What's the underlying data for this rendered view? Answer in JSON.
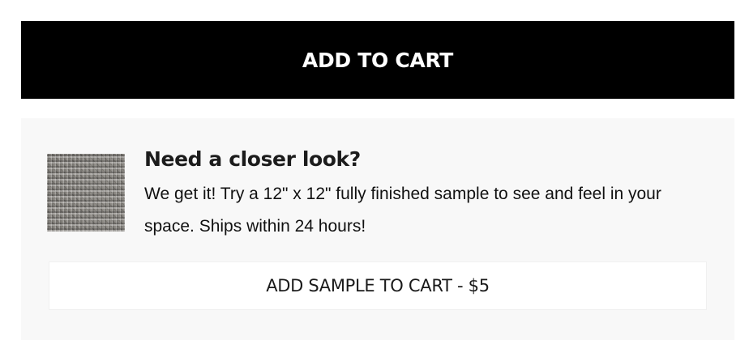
{
  "primary_action": {
    "label": "ADD TO CART"
  },
  "sample_offer": {
    "swatch_icon": "fabric-swatch-image",
    "heading": "Need a closer look?",
    "description": "We get it! Try a 12\" x 12\" fully finished sample to see and feel in your space. Ships within 24 hours!",
    "button_label": "ADD SAMPLE TO CART - $5"
  },
  "colors": {
    "primary_button_bg": "#000000",
    "primary_button_text": "#ffffff",
    "panel_bg": "#f8f8f8",
    "sample_button_bg": "#ffffff"
  }
}
